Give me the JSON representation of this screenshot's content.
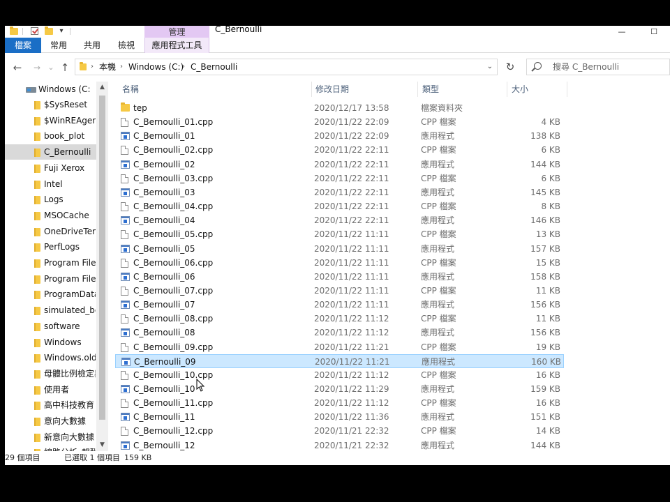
{
  "window": {
    "title": "C_Bernoulli",
    "context_group": "管理",
    "controls": {
      "minimize": "—",
      "maximize": "☐"
    }
  },
  "quick_access": {
    "dropdown": "▾"
  },
  "ribbon": {
    "tabs": [
      {
        "label": "檔案",
        "kind": "file"
      },
      {
        "label": "常用",
        "kind": "normal"
      },
      {
        "label": "共用",
        "kind": "normal"
      },
      {
        "label": "檢視",
        "kind": "normal"
      },
      {
        "label": "應用程式工具",
        "kind": "context"
      }
    ]
  },
  "navigation": {
    "back": "←",
    "forward": "→",
    "recent": "⌄",
    "up": "↑",
    "refresh": "↻"
  },
  "address_bar": {
    "path": [
      "本機",
      "Windows (C:)",
      "C_Bernoulli"
    ],
    "separator": "›",
    "dropdown": "⌄"
  },
  "search": {
    "placeholder": "搜尋 C_Bernoulli"
  },
  "nav_pane": {
    "drive": "Windows (C:)",
    "items": [
      {
        "label": "$SysReset",
        "selected": false
      },
      {
        "label": "$WinREAgent",
        "selected": false
      },
      {
        "label": "book_plot",
        "selected": false
      },
      {
        "label": "C_Bernoulli",
        "selected": true
      },
      {
        "label": "Fuji Xerox",
        "selected": false
      },
      {
        "label": "Intel",
        "selected": false
      },
      {
        "label": "Logs",
        "selected": false
      },
      {
        "label": "MSOCache",
        "selected": false
      },
      {
        "label": "OneDriveTem",
        "selected": false
      },
      {
        "label": "PerfLogs",
        "selected": false
      },
      {
        "label": "Program Files",
        "selected": false
      },
      {
        "label": "Program Files",
        "selected": false
      },
      {
        "label": "ProgramData",
        "selected": false
      },
      {
        "label": "simulated_boo",
        "selected": false
      },
      {
        "label": "software",
        "selected": false
      },
      {
        "label": "Windows",
        "selected": false
      },
      {
        "label": "Windows.old",
        "selected": false
      },
      {
        "label": "母體比例檢定與",
        "selected": false
      },
      {
        "label": "使用者",
        "selected": false
      },
      {
        "label": "高中科技教育",
        "selected": false
      },
      {
        "label": "意向大數據",
        "selected": false
      },
      {
        "label": "新意向大數據",
        "selected": false
      },
      {
        "label": "線路分析_報酬",
        "selected": false
      }
    ],
    "scroll_up": "▲",
    "scroll_down": "▼"
  },
  "columns": {
    "name": "名稱",
    "date": "修改日期",
    "type": "類型",
    "size": "大小",
    "sort_indicator": "^"
  },
  "files": [
    {
      "name": "tep",
      "date": "2020/12/17 13:58",
      "type": "檔案資料夾",
      "size": "",
      "icon": "folder-icon",
      "selected": false
    },
    {
      "name": "C_Bernoulli_01.cpp",
      "date": "2020/11/22 22:09",
      "type": "CPP 檔案",
      "size": "4 KB",
      "icon": "document-icon",
      "selected": false
    },
    {
      "name": "C_Bernoulli_01",
      "date": "2020/11/22 22:09",
      "type": "應用程式",
      "size": "138 KB",
      "icon": "application-icon",
      "selected": false
    },
    {
      "name": "C_Bernoulli_02.cpp",
      "date": "2020/11/22 22:11",
      "type": "CPP 檔案",
      "size": "6 KB",
      "icon": "document-icon",
      "selected": false
    },
    {
      "name": "C_Bernoulli_02",
      "date": "2020/11/22 22:11",
      "type": "應用程式",
      "size": "144 KB",
      "icon": "application-icon",
      "selected": false
    },
    {
      "name": "C_Bernoulli_03.cpp",
      "date": "2020/11/22 22:11",
      "type": "CPP 檔案",
      "size": "6 KB",
      "icon": "document-icon",
      "selected": false
    },
    {
      "name": "C_Bernoulli_03",
      "date": "2020/11/22 22:11",
      "type": "應用程式",
      "size": "145 KB",
      "icon": "application-icon",
      "selected": false
    },
    {
      "name": "C_Bernoulli_04.cpp",
      "date": "2020/11/22 22:11",
      "type": "CPP 檔案",
      "size": "8 KB",
      "icon": "document-icon",
      "selected": false
    },
    {
      "name": "C_Bernoulli_04",
      "date": "2020/11/22 22:11",
      "type": "應用程式",
      "size": "146 KB",
      "icon": "application-icon",
      "selected": false
    },
    {
      "name": "C_Bernoulli_05.cpp",
      "date": "2020/11/22 11:11",
      "type": "CPP 檔案",
      "size": "13 KB",
      "icon": "document-icon",
      "selected": false
    },
    {
      "name": "C_Bernoulli_05",
      "date": "2020/11/22 11:11",
      "type": "應用程式",
      "size": "157 KB",
      "icon": "application-icon",
      "selected": false
    },
    {
      "name": "C_Bernoulli_06.cpp",
      "date": "2020/11/22 11:11",
      "type": "CPP 檔案",
      "size": "15 KB",
      "icon": "document-icon",
      "selected": false
    },
    {
      "name": "C_Bernoulli_06",
      "date": "2020/11/22 11:11",
      "type": "應用程式",
      "size": "158 KB",
      "icon": "application-icon",
      "selected": false
    },
    {
      "name": "C_Bernoulli_07.cpp",
      "date": "2020/11/22 11:11",
      "type": "CPP 檔案",
      "size": "11 KB",
      "icon": "document-icon",
      "selected": false
    },
    {
      "name": "C_Bernoulli_07",
      "date": "2020/11/22 11:11",
      "type": "應用程式",
      "size": "156 KB",
      "icon": "application-icon",
      "selected": false
    },
    {
      "name": "C_Bernoulli_08.cpp",
      "date": "2020/11/22 11:12",
      "type": "CPP 檔案",
      "size": "11 KB",
      "icon": "document-icon",
      "selected": false
    },
    {
      "name": "C_Bernoulli_08",
      "date": "2020/11/22 11:12",
      "type": "應用程式",
      "size": "156 KB",
      "icon": "application-icon",
      "selected": false
    },
    {
      "name": "C_Bernoulli_09.cpp",
      "date": "2020/11/22 11:21",
      "type": "CPP 檔案",
      "size": "19 KB",
      "icon": "document-icon",
      "selected": false
    },
    {
      "name": "C_Bernoulli_09",
      "date": "2020/11/22 11:21",
      "type": "應用程式",
      "size": "160 KB",
      "icon": "application-icon",
      "selected": true
    },
    {
      "name": "C_Bernoulli_10.cpp",
      "date": "2020/11/22 11:12",
      "type": "CPP 檔案",
      "size": "16 KB",
      "icon": "document-icon",
      "selected": false
    },
    {
      "name": "C_Bernoulli_10",
      "date": "2020/11/22 11:29",
      "type": "應用程式",
      "size": "159 KB",
      "icon": "application-icon",
      "selected": false
    },
    {
      "name": "C_Bernoulli_11.cpp",
      "date": "2020/11/22 11:12",
      "type": "CPP 檔案",
      "size": "16 KB",
      "icon": "document-icon",
      "selected": false
    },
    {
      "name": "C_Bernoulli_11",
      "date": "2020/11/22 11:36",
      "type": "應用程式",
      "size": "151 KB",
      "icon": "application-icon",
      "selected": false
    },
    {
      "name": "C_Bernoulli_12.cpp",
      "date": "2020/11/21 22:32",
      "type": "CPP 檔案",
      "size": "14 KB",
      "icon": "document-icon",
      "selected": false
    },
    {
      "name": "C_Bernoulli_12",
      "date": "2020/11/21 22:32",
      "type": "應用程式",
      "size": "144 KB",
      "icon": "application-icon",
      "selected": false
    }
  ],
  "status_bar": {
    "item_count": "29 個項目",
    "selection": "已選取 1 個項目",
    "selection_size": "159 KB"
  }
}
